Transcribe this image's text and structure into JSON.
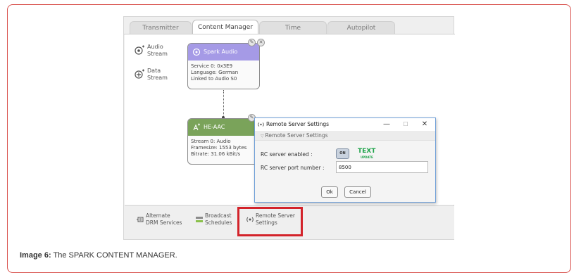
{
  "tabs": [
    {
      "label": "Transmitter",
      "active": false
    },
    {
      "label": "Content Manager",
      "active": true
    },
    {
      "label": "Time",
      "active": false
    },
    {
      "label": "Autopilot",
      "active": false
    }
  ],
  "palette": [
    {
      "label": "Audio\nStream",
      "icon": "audio-stream-icon"
    },
    {
      "label": "Data\nStream",
      "icon": "data-stream-icon"
    }
  ],
  "nodes": {
    "spark": {
      "title": "Spark Audio",
      "lines": [
        "Service 0: 0x3E9",
        "Language: German",
        "Linked to Audio S0"
      ],
      "color": "#a59ae6"
    },
    "heaac": {
      "title": "HE-AAC",
      "lines": [
        "Stream 0: Audio",
        "Framesize: 1553 bytes",
        "Bitrate: 31.06 kBit/s"
      ],
      "color": "#7aa35a"
    }
  },
  "bottom_bar": [
    {
      "label": "Alternate\nDRM Services",
      "icon": "alternate-services-icon"
    },
    {
      "label": "Broadcast\nSchedules",
      "icon": "schedules-icon"
    },
    {
      "label": "Remote Server\nSettings",
      "icon": "remote-server-icon"
    }
  ],
  "dialog": {
    "title": "Remote Server Settings",
    "minimize": "—",
    "maximize": "☐",
    "close": "✕",
    "section": "Remote Server Settings",
    "enabled_label": "RC server enabled :",
    "toggle_text": "ON",
    "logo_text": "TEXT",
    "logo_sub": "UPDATE",
    "port_label": "RC server port number :",
    "port_value": "8500",
    "ok_label": "Ok",
    "cancel_label": "Cancel"
  },
  "caption": {
    "prefix": "Image 6:",
    "text": " The SPARK CONTENT MANAGER."
  },
  "colors": {
    "frame_border": "#d9534f",
    "highlight": "#d3232a",
    "dialog_border": "#6f9fd8"
  }
}
